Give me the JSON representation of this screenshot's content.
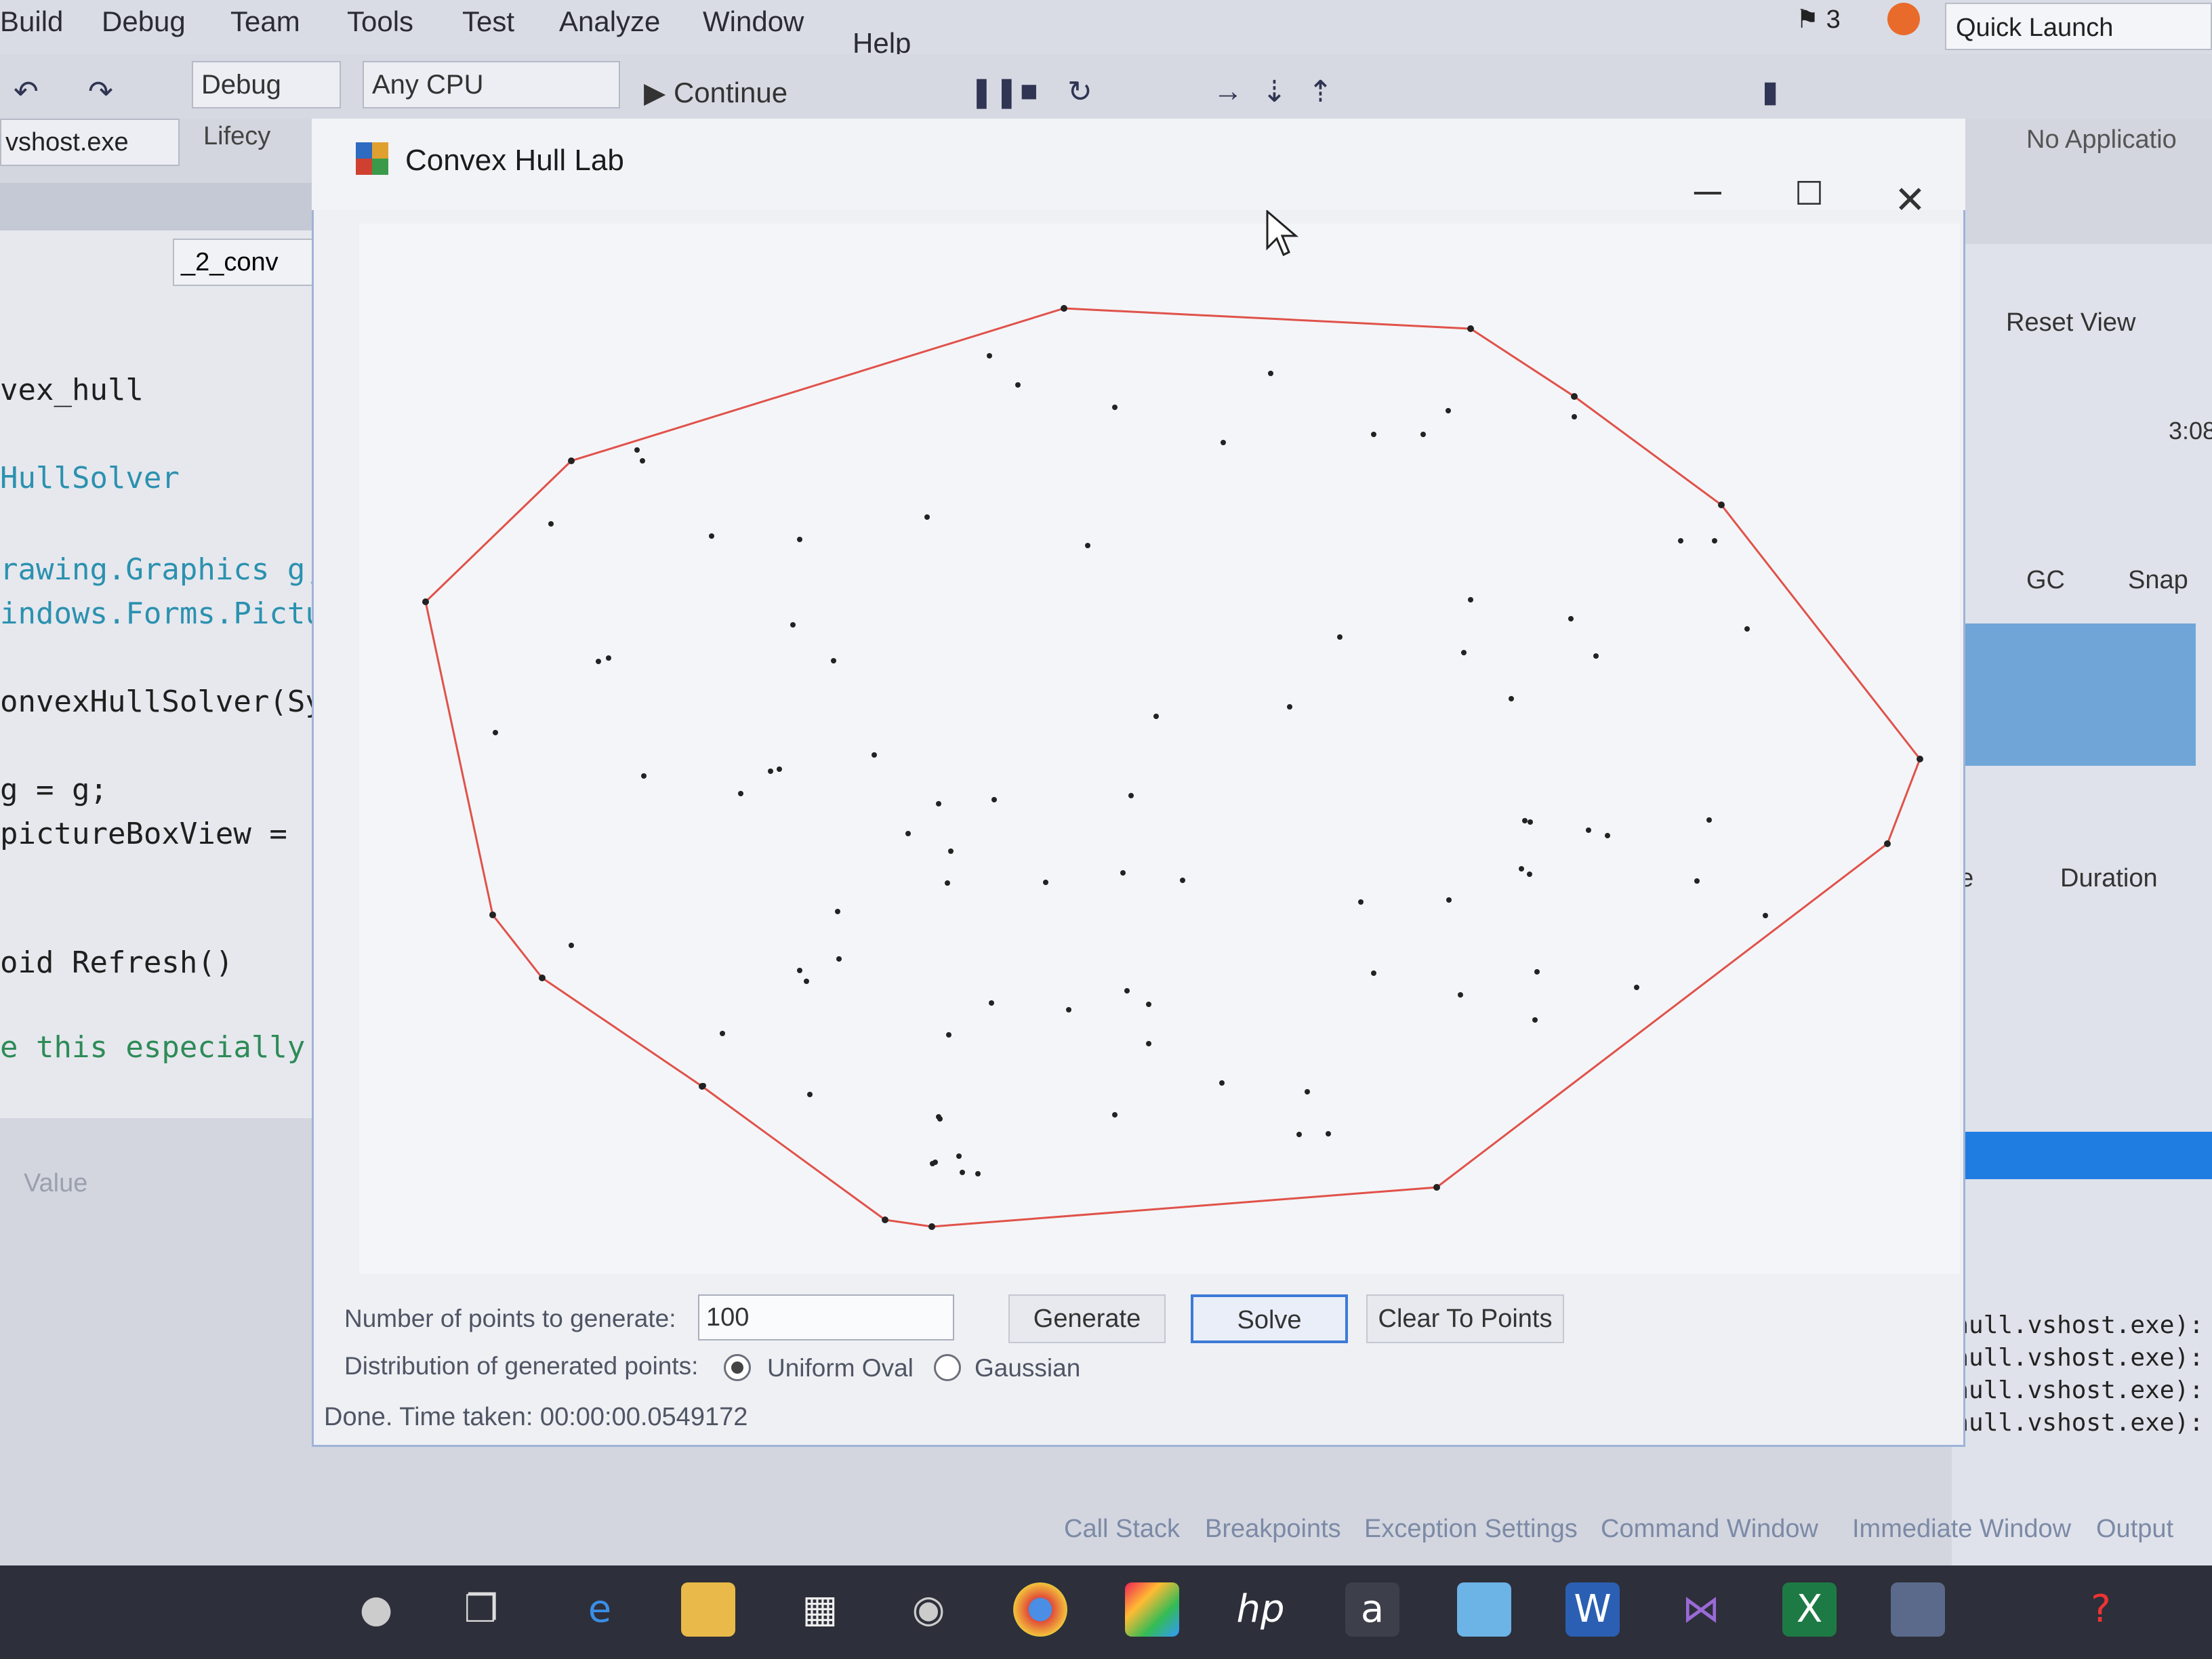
{
  "vs": {
    "menu": [
      "Build",
      "Debug",
      "Team",
      "Tools",
      "Test",
      "Analyze",
      "Window",
      "Help"
    ],
    "feedback_count": "3",
    "quick_launch": "Quick Launch (Ctrl+Q)",
    "config": "Debug",
    "platform": "Any CPU",
    "continue_label": "Continue",
    "process": "vshost.exe",
    "lifecycle": "Lifecy",
    "no_application": "No Applicatio",
    "code_nav": "_2_conv",
    "code_lines": [
      "vex_hull",
      "HullSolver",
      "rawing.Graphics g;",
      "indows.Forms.Pictu",
      "onvexHullSolver(Sy",
      "g = g;",
      "pictureBoxView =",
      "oid Refresh()",
      "e this especially"
    ],
    "value_header": "Value",
    "reset_view": "Reset View",
    "time_mark": "3:08",
    "gc": "GC",
    "snap": "Snap",
    "col_name": "ne",
    "col_duration": "Duration",
    "output_lines": [
      ":-hull.vshost.exe):",
      ":-hull.vshost.exe):",
      ":-hull.vshost.exe):",
      ":-hull.vshost.exe):"
    ],
    "bottom_tabs": [
      "Call Stack",
      "Breakpoints",
      "Exception Settings",
      "Command Window",
      "Immediate Window",
      "Output"
    ]
  },
  "app": {
    "title": "Convex Hull Lab",
    "num_points_label": "Number of points to generate:",
    "num_points_value": "100",
    "generate_label": "Generate",
    "solve_label": "Solve",
    "clear_label": "Clear To Points",
    "distribution_label": "Distribution of generated points:",
    "uniform_label": "Uniform Oval",
    "gaussian_label": "Gaussian",
    "selected_distribution": "Uniform Oval",
    "status": "Done.  Time taken: 00:00:00.0549172"
  },
  "colors": {
    "hull_line": "#e0524a",
    "point": "#222222",
    "accent": "#3d7ad6"
  },
  "taskbar_icons": [
    "mic-icon",
    "task-view-icon",
    "edge-icon",
    "file-explorer-icon",
    "store-icon",
    "camera-icon",
    "chrome-icon",
    "paint-icon",
    "hp-icon",
    "amazon-icon",
    "onedrive-icon",
    "word-icon",
    "visual-studio-icon",
    "excel-icon",
    "convex-hull-app-icon",
    "help-icon"
  ]
}
